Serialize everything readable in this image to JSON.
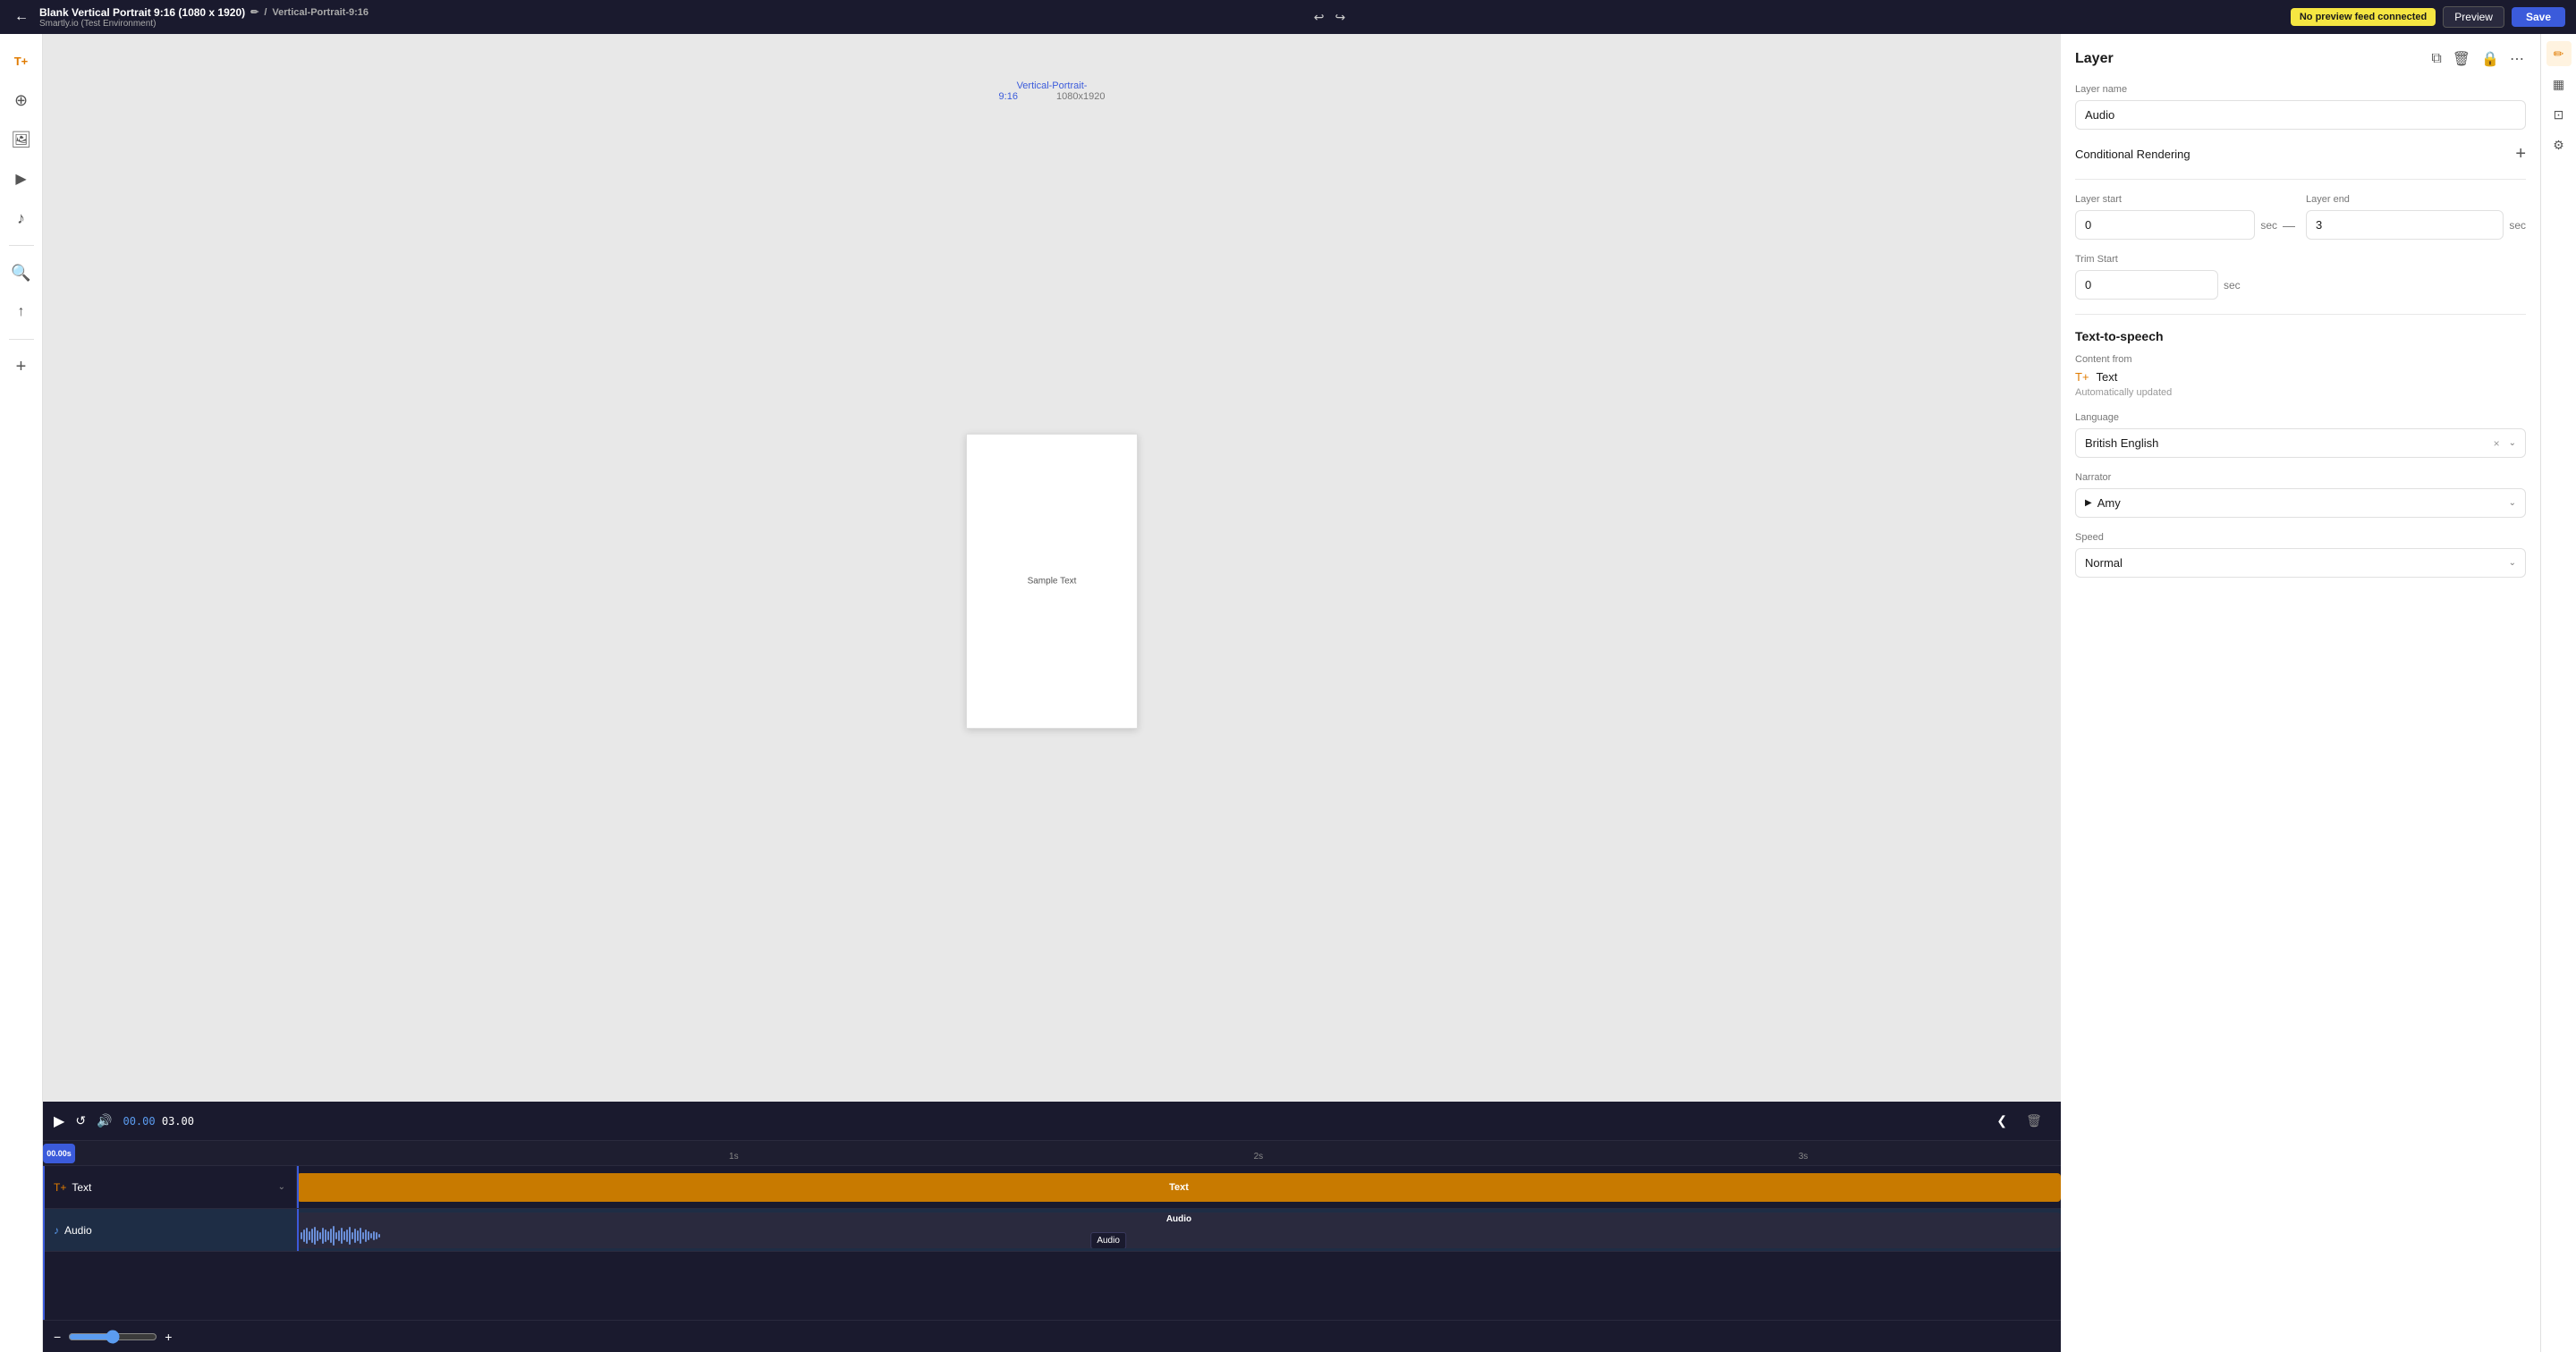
{
  "topbar": {
    "back_label": "←",
    "title": "Blank Vertical Portrait 9:16 (1080 x 1920)",
    "subtitle": "Smartly.io (Test Environment)",
    "edit_icon": "✏",
    "slash": "/",
    "file_name": "Vertical-Portrait-9:16",
    "undo_icon": "↩",
    "redo_icon": "↪",
    "no_preview_label": "No preview feed connected",
    "preview_label": "Preview",
    "save_label": "Save"
  },
  "left_toolbar": {
    "add_icon": "T+",
    "feed_icon": "⊕",
    "image_icon": "🖼",
    "video_icon": "▶",
    "music_icon": "♪",
    "search_icon": "🔍",
    "upload_icon": "↑",
    "plus_icon": "+"
  },
  "canvas": {
    "template_name": "Vertical-Portrait-",
    "template_name2": "9:16",
    "dimensions": "1080x1920",
    "sample_text": "Sample Text"
  },
  "far_right": {
    "brush_icon": "✏",
    "grid_icon": "▦",
    "transform_icon": "⊡",
    "settings_icon": "⚙"
  },
  "layer_panel": {
    "title": "Layer",
    "copy_icon": "⧉",
    "delete_icon": "🗑",
    "lock_icon": "🔒",
    "more_icon": "⋯",
    "layer_name_label": "Layer name",
    "layer_name_value": "Audio",
    "conditional_rendering_label": "Conditional Rendering",
    "plus_icon": "+",
    "layer_start_label": "Layer start",
    "layer_start_value": "0",
    "layer_start_unit": "sec",
    "layer_end_label": "Layer end",
    "layer_end_value": "3",
    "layer_end_unit": "sec",
    "dash": "—",
    "trim_start_label": "Trim Start",
    "trim_start_value": "0",
    "trim_start_unit": "sec",
    "tts_title": "Text-to-speech",
    "content_from_label": "Content from",
    "content_icon": "T+",
    "content_value": "Text",
    "auto_updated_label": "Automatically updated",
    "language_label": "Language",
    "language_value": "British English",
    "language_x": "×",
    "language_chevron": "⌄",
    "narrator_label": "Narrator",
    "narrator_play": "▶",
    "narrator_value": "Amy",
    "narrator_chevron": "⌄",
    "speed_label": "Speed",
    "speed_value": "Normal",
    "speed_chevron": "⌄"
  },
  "timeline": {
    "play_icon": "▶",
    "replay_icon": "↺",
    "volume_icon": "🔊",
    "time_current": "00.00",
    "time_total": "03.00",
    "collapse_icon": "❮",
    "playhead_label": "00.00s",
    "ruler_marks": [
      "1s",
      "2s",
      "3s"
    ],
    "ruler_positions": [
      "34%",
      "60%",
      "87%"
    ],
    "text_track_label": "Text",
    "text_layer_name": "Text",
    "text_icon": "T+",
    "audio_track_label": "Audio",
    "audio_layer_name": "Audio",
    "audio_icon": "♪",
    "audio_inner_label": "Audio",
    "audio_tooltip": "Audio",
    "delete_icon": "🗑",
    "zoom_minus": "−",
    "zoom_plus": "+",
    "zoom_value": 50
  }
}
